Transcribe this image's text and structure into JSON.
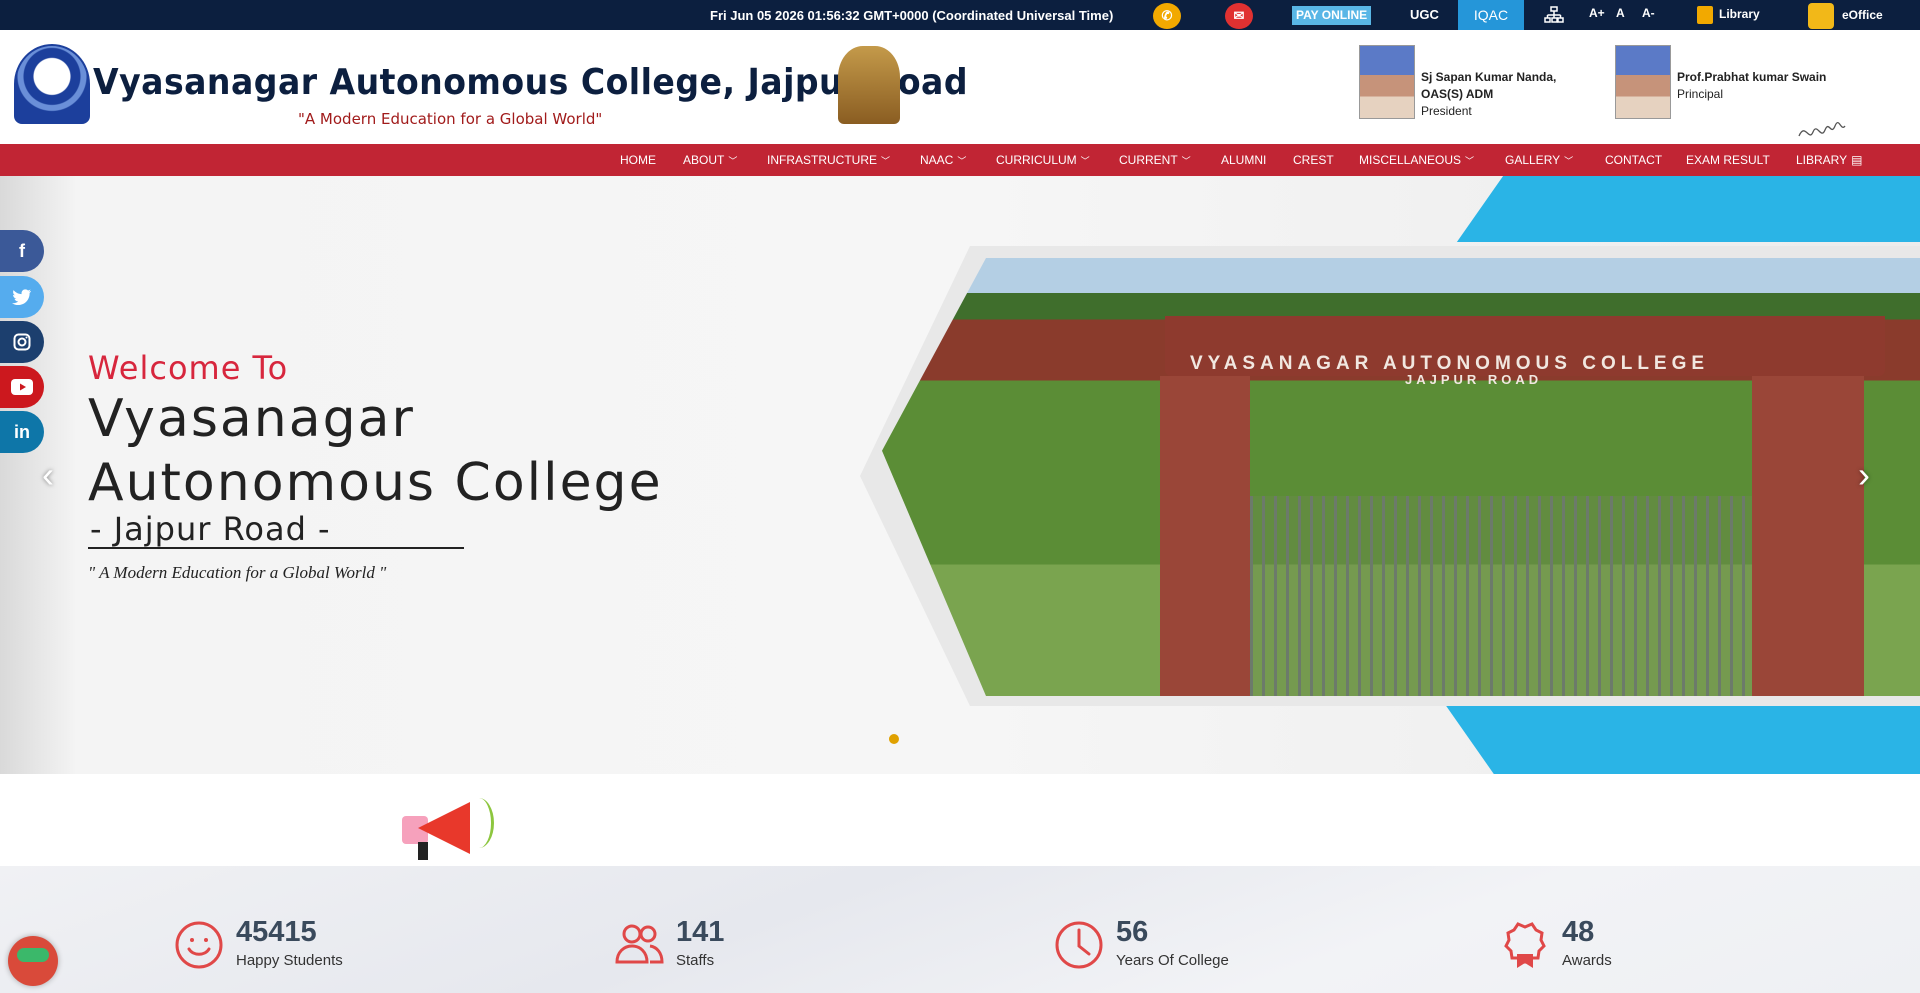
{
  "topbar": {
    "datetime": "Fri Jun 05 2026 01:56:32 GMT+0000 (Coordinated Universal Time)",
    "pay_online": "PAY ONLINE",
    "ugc": "UGC",
    "iqac": "IQAC",
    "font_increase": "A+",
    "font_normal": "A",
    "font_decrease": "A-",
    "library": "Library",
    "eoffice": "eOffice"
  },
  "header": {
    "college_name": "Vyasanagar Autonomous College, Jajpur Road",
    "tagline": "\"A Modern Education for a Global World\"",
    "people": [
      {
        "name_line1": "Sj Sapan Kumar Nanda,",
        "name_line2": "OAS(S) ADM",
        "role": "President"
      },
      {
        "name_line1": "Prof.Prabhat kumar Swain",
        "name_line2": "",
        "role": "Principal"
      }
    ]
  },
  "nav": {
    "items": [
      {
        "label": "HOME",
        "dropdown": false
      },
      {
        "label": "ABOUT",
        "dropdown": true
      },
      {
        "label": "INFRASTRUCTURE",
        "dropdown": true
      },
      {
        "label": "NAAC",
        "dropdown": true
      },
      {
        "label": "CURRICULUM",
        "dropdown": true
      },
      {
        "label": "CURRENT",
        "dropdown": true
      },
      {
        "label": "ALUMNI",
        "dropdown": false
      },
      {
        "label": "CREST",
        "dropdown": false
      },
      {
        "label": "MISCELLANEOUS",
        "dropdown": true
      },
      {
        "label": "GALLERY",
        "dropdown": true
      },
      {
        "label": "CONTACT",
        "dropdown": false
      },
      {
        "label": "EXAM RESULT",
        "dropdown": false
      },
      {
        "label": "LIBRARY",
        "dropdown": false
      }
    ]
  },
  "hero": {
    "welcome": "Welcome To",
    "title_line1": "Vyasanagar",
    "title_line2": "Autonomous College",
    "title_line3": "- Jajpur Road -",
    "motto": "\" A Modern Education for a Global World \"",
    "arch_text": "VYASANAGAR AUTONOMOUS COLLEGE",
    "arch_text2": "JAJPUR ROAD",
    "prev_arrow": "‹",
    "next_arrow": "›"
  },
  "social": [
    "f",
    "t",
    "ig",
    "yt",
    "in"
  ],
  "stats": [
    {
      "value": "45415",
      "label": "Happy Students",
      "icon": "smiley-icon"
    },
    {
      "value": "141",
      "label": "Staffs",
      "icon": "people-icon"
    },
    {
      "value": "56",
      "label": "Years Of College",
      "icon": "clock-icon"
    },
    {
      "value": "48",
      "label": "Awards",
      "icon": "award-icon"
    }
  ],
  "colors": {
    "topbar": "#0c1f3f",
    "nav": "#c12534",
    "accent_blue": "#2ab4e6",
    "stat_icon": "#e04848"
  }
}
